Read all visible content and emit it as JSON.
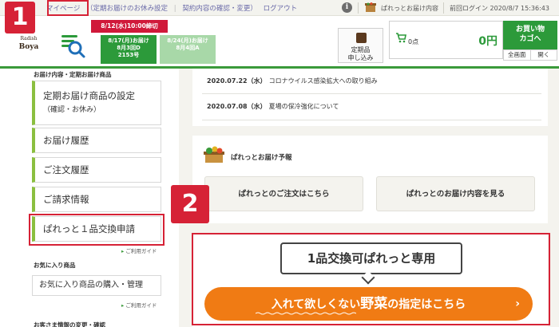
{
  "topbar": {
    "mypage": "マイページ",
    "links": [
      "（定期お届けのお休み設定",
      "契約内容の確認・変更）",
      "ログアウト"
    ],
    "info_icon": "i",
    "palette_label": "ぱれっとお届け内容",
    "last_login": "前回ログイン 2020/8/7 15:36:43"
  },
  "header": {
    "logo_top": "Radish",
    "logo_bottom": "Boya",
    "date_banner": "8/12(水)10:00締切",
    "deliveries": [
      {
        "line1": "8/17(月)お届け",
        "line2": "8月3回D",
        "line3": "2153号"
      },
      {
        "line1": "8/24(月)お届け",
        "line2": "8月4回A",
        "line3": ""
      }
    ],
    "teiki": {
      "line1": "定期品",
      "line2": "申し込み"
    },
    "cart": {
      "points": "0点",
      "amount": "0円"
    },
    "buy_button": {
      "line1": "お買い物",
      "line2": "カゴへ"
    },
    "view_tabs": [
      "全画面",
      "開く"
    ]
  },
  "sidebar": {
    "section1_heading": "お届け内容・定期お届け商品",
    "items": [
      {
        "label": "定期お届け商品の設定",
        "sub": "（確認・お休み）"
      },
      {
        "label": "お届け履歴"
      },
      {
        "label": "ご注文履歴"
      },
      {
        "label": "ご請求情報"
      },
      {
        "label": "ぱれっと１品交換申請"
      }
    ],
    "guide": "ご利用ガイド",
    "section2_heading": "お気に入り商品",
    "fav_item": "お気に入り商品の購入・管理",
    "guide2": "ご利用ガイド",
    "section3_heading": "お客さま情報の変更・確認"
  },
  "news": [
    {
      "date": "2020.07.22（水）",
      "text": "コロナウイルス感染拡大への取り組み"
    },
    {
      "date": "2020.07.08（水）",
      "text": "夏場の保冷強化について"
    }
  ],
  "pallet": {
    "title": "ぱれっとお届け予報",
    "button1": "ぱれっとのご注文はこちら",
    "button2": "ぱれっとのお届け内容を見る"
  },
  "promo": {
    "bubble": "1品交換可ぱれっと専用",
    "cta_pre": "入れて欲しくない",
    "cta_veg": "野菜",
    "cta_post": "の指定はこちら",
    "cta_chevron": "›"
  },
  "annotations": {
    "badge1": "1",
    "badge2": "2"
  },
  "colors": {
    "brand_green": "#2c9a3a",
    "alert_red": "#d62236",
    "cta_orange": "#f07b14"
  }
}
